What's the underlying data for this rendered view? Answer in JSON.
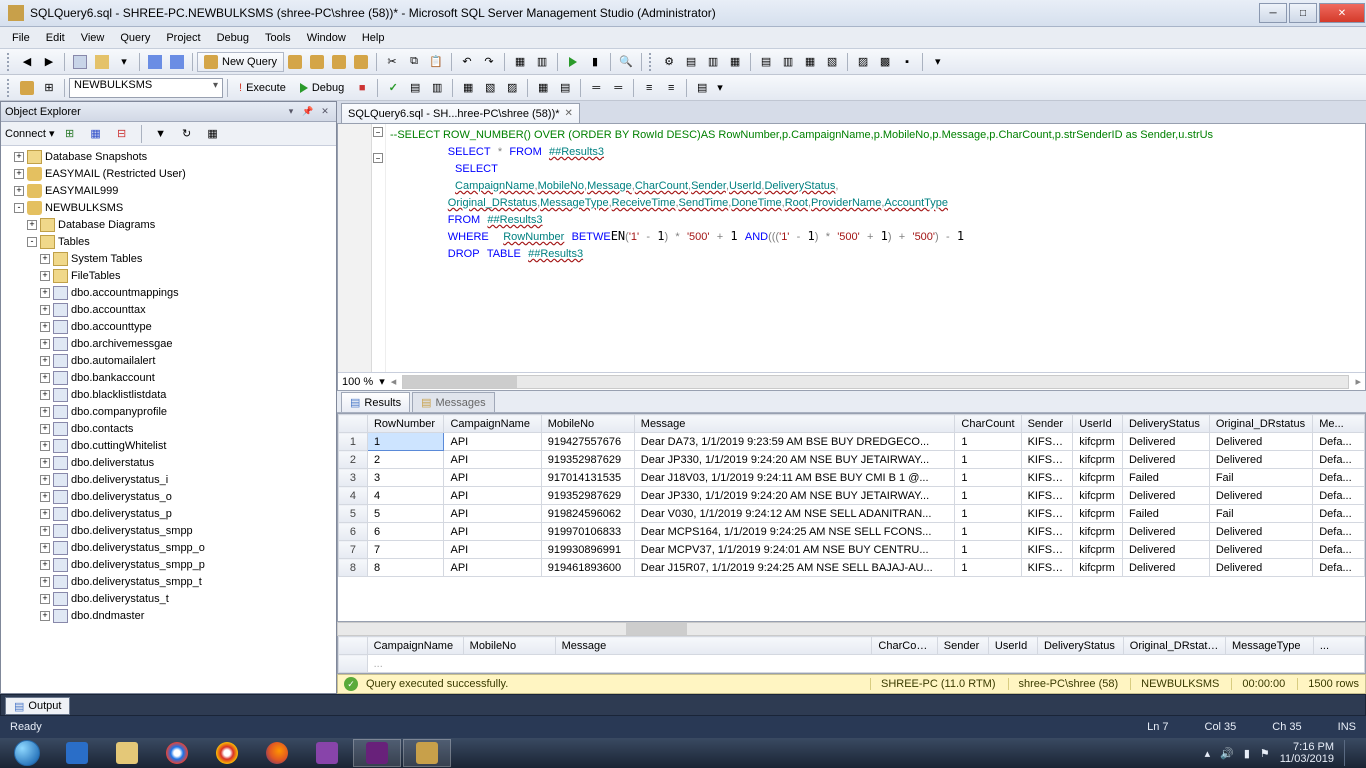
{
  "window": {
    "title": "SQLQuery6.sql - SHREE-PC.NEWBULKSMS (shree-PC\\shree (58))* - Microsoft SQL Server Management Studio (Administrator)"
  },
  "menu": [
    "File",
    "Edit",
    "View",
    "Query",
    "Project",
    "Debug",
    "Tools",
    "Window",
    "Help"
  ],
  "toolbar1": {
    "new_query": "New Query"
  },
  "toolbar2": {
    "db_select": "NEWBULKSMS",
    "execute": "Execute",
    "debug": "Debug"
  },
  "object_explorer": {
    "title": "Object Explorer",
    "connect": "Connect ▾",
    "nodes": [
      {
        "depth": 1,
        "exp": "+",
        "icon": "folder",
        "label": "Database Snapshots"
      },
      {
        "depth": 1,
        "exp": "+",
        "icon": "db",
        "label": "EASYMAIL (Restricted User)"
      },
      {
        "depth": 1,
        "exp": "+",
        "icon": "db",
        "label": "EASYMAIL999"
      },
      {
        "depth": 1,
        "exp": "-",
        "icon": "db",
        "label": "NEWBULKSMS"
      },
      {
        "depth": 2,
        "exp": "+",
        "icon": "folder",
        "label": "Database Diagrams"
      },
      {
        "depth": 2,
        "exp": "-",
        "icon": "folder",
        "label": "Tables"
      },
      {
        "depth": 3,
        "exp": "+",
        "icon": "folder",
        "label": "System Tables"
      },
      {
        "depth": 3,
        "exp": "+",
        "icon": "folder",
        "label": "FileTables"
      },
      {
        "depth": 3,
        "exp": "+",
        "icon": "table",
        "label": "dbo.accountmappings"
      },
      {
        "depth": 3,
        "exp": "+",
        "icon": "table",
        "label": "dbo.accounttax"
      },
      {
        "depth": 3,
        "exp": "+",
        "icon": "table",
        "label": "dbo.accounttype"
      },
      {
        "depth": 3,
        "exp": "+",
        "icon": "table",
        "label": "dbo.archivemessgae"
      },
      {
        "depth": 3,
        "exp": "+",
        "icon": "table",
        "label": "dbo.automailalert"
      },
      {
        "depth": 3,
        "exp": "+",
        "icon": "table",
        "label": "dbo.bankaccount"
      },
      {
        "depth": 3,
        "exp": "+",
        "icon": "table",
        "label": "dbo.blacklistlistdata"
      },
      {
        "depth": 3,
        "exp": "+",
        "icon": "table",
        "label": "dbo.companyprofile"
      },
      {
        "depth": 3,
        "exp": "+",
        "icon": "table",
        "label": "dbo.contacts"
      },
      {
        "depth": 3,
        "exp": "+",
        "icon": "table",
        "label": "dbo.cuttingWhitelist"
      },
      {
        "depth": 3,
        "exp": "+",
        "icon": "table",
        "label": "dbo.deliverstatus"
      },
      {
        "depth": 3,
        "exp": "+",
        "icon": "table",
        "label": "dbo.deliverystatus_i"
      },
      {
        "depth": 3,
        "exp": "+",
        "icon": "table",
        "label": "dbo.deliverystatus_o"
      },
      {
        "depth": 3,
        "exp": "+",
        "icon": "table",
        "label": "dbo.deliverystatus_p"
      },
      {
        "depth": 3,
        "exp": "+",
        "icon": "table",
        "label": "dbo.deliverystatus_smpp"
      },
      {
        "depth": 3,
        "exp": "+",
        "icon": "table",
        "label": "dbo.deliverystatus_smpp_o"
      },
      {
        "depth": 3,
        "exp": "+",
        "icon": "table",
        "label": "dbo.deliverystatus_smpp_p"
      },
      {
        "depth": 3,
        "exp": "+",
        "icon": "table",
        "label": "dbo.deliverystatus_smpp_t"
      },
      {
        "depth": 3,
        "exp": "+",
        "icon": "table",
        "label": "dbo.deliverystatus_t"
      },
      {
        "depth": 3,
        "exp": "+",
        "icon": "table",
        "label": "dbo.dndmaster"
      }
    ]
  },
  "editor": {
    "tab": "SQLQuery6.sql - SH...hree-PC\\shree (58))*",
    "code_html": "<span class='c-cmt'>--SELECT ROW_NUMBER() OVER (ORDER BY RowId DESC)AS RowNumber,p.CampaignName,p.MobileNo,p.Message,p.CharCount,p.strSenderID as Sender,u.strUs</span>\n        <span class='c-kw'>SELECT</span> <span class='c-gray'>*</span> <span class='c-kw'>FROM</span> <span class='c-obj'>##Results3</span>\n         <span class='c-kw'>SELECT</span>\n         <span class='c-obj'>CampaignName</span><span class='c-gray'>,</span><span class='c-obj'>MobileNo</span><span class='c-gray'>,</span><span class='c-obj'>Message</span><span class='c-gray'>,</span><span class='c-obj'>CharCount</span><span class='c-gray'>,</span><span class='c-obj'>Sender</span><span class='c-gray'>,</span><span class='c-obj'>UserId</span><span class='c-gray'>,</span><span class='c-obj'>DeliveryStatus</span><span class='c-gray'>,</span>\n        <span class='c-obj'>Original_DRstatus</span><span class='c-gray'>,</span><span class='c-obj'>MessageType</span><span class='c-gray'>,</span><span class='c-obj'>ReceiveTime</span><span class='c-gray'>,</span><span class='c-obj'>SendTime</span><span class='c-gray'>,</span><span class='c-obj'>DoneTime</span><span class='c-gray'>,</span><span class='c-obj'>Root</span><span class='c-gray'>,</span><span class='c-obj'>ProviderName</span><span class='c-gray'>,</span><span class='c-obj'>AccountType</span>\n        <span class='c-kw'>FROM</span> <span class='c-obj'>##Results3</span>\n        <span class='c-kw'>WHERE</span>  <span class='c-obj'>RowNumber</span> <span class='c-kw'>BETWE</span>EN<span class='c-gray'>(</span><span class='c-str'>'1'</span> <span class='c-gray'>-</span> 1<span class='c-gray'>)</span> <span class='c-gray'>*</span> <span class='c-str'>'500'</span> <span class='c-gray'>+</span> 1 <span class='c-kw'>AND</span><span class='c-gray'>(((</span><span class='c-str'>'1'</span> <span class='c-gray'>-</span> 1<span class='c-gray'>)</span> <span class='c-gray'>*</span> <span class='c-str'>'500'</span> <span class='c-gray'>+</span> 1<span class='c-gray'>)</span> <span class='c-gray'>+</span> <span class='c-str'>'500'</span><span class='c-gray'>)</span> <span class='c-gray'>-</span> 1\n        <span class='c-kw'>DROP</span> <span class='c-kw'>TABLE</span> <span class='c-obj'>##Results3</span>",
    "zoom": "100 %"
  },
  "results": {
    "tab_results": "Results",
    "tab_messages": "Messages",
    "columns": [
      "",
      "RowNumber",
      "CampaignName",
      "MobileNo",
      "Message",
      "CharCount",
      "Sender",
      "UserId",
      "DeliveryStatus",
      "Original_DRstatus",
      "Me..."
    ],
    "rows": [
      [
        "1",
        "1",
        "API",
        "919427557676",
        "Dear DA73, 1/1/2019 9:23:59 AM   BSE BUY DREDGECO...",
        "1",
        "KIFSTR",
        "kifcprm",
        "Delivered",
        "Delivered",
        "Defa..."
      ],
      [
        "2",
        "2",
        "API",
        "919352987629",
        "Dear JP330, 1/1/2019 9:24:20 AM   NSE BUY JETAIRWAY...",
        "1",
        "KIFSTR",
        "kifcprm",
        "Delivered",
        "Delivered",
        "Defa..."
      ],
      [
        "3",
        "3",
        "API",
        "917014131535",
        "Dear J18V03, 1/1/2019 9:24:11 AM   BSE BUY CMI B   1 @...",
        "1",
        "KIFSTR",
        "kifcprm",
        "Failed",
        "Fail",
        "Defa..."
      ],
      [
        "4",
        "4",
        "API",
        "919352987629",
        "Dear JP330, 1/1/2019 9:24:20 AM   NSE BUY JETAIRWAY...",
        "1",
        "KIFSTR",
        "kifcprm",
        "Delivered",
        "Delivered",
        "Defa..."
      ],
      [
        "5",
        "5",
        "API",
        "919824596062",
        "Dear V030, 1/1/2019 9:24:12 AM   NSE SELL ADANITRAN...",
        "1",
        "KIFSTR",
        "kifcprm",
        "Failed",
        "Fail",
        "Defa..."
      ],
      [
        "6",
        "6",
        "API",
        "919970106833",
        "Dear MCPS164, 1/1/2019 9:24:25 AM   NSE SELL FCONS...",
        "1",
        "KIFSTR",
        "kifcprm",
        "Delivered",
        "Delivered",
        "Defa..."
      ],
      [
        "7",
        "7",
        "API",
        "919930896991",
        "Dear MCPV37, 1/1/2019 9:24:01 AM   NSE BUY CENTRU...",
        "1",
        "KIFSTR",
        "kifcprm",
        "Delivered",
        "Delivered",
        "Defa..."
      ],
      [
        "8",
        "8",
        "API",
        "919461893600",
        "Dear J15R07, 1/1/2019 9:24:25 AM   NSE SELL BAJAJ-AU...",
        "1",
        "KIFSTR",
        "kifcprm",
        "Delivered",
        "Delivered",
        "Defa..."
      ]
    ],
    "second_columns": [
      "",
      "CampaignName",
      "MobileNo",
      "Message",
      "CharCount",
      "Sender",
      "UserId",
      "DeliveryStatus",
      "Original_DRstatus",
      "MessageType",
      "..."
    ]
  },
  "status_yellow": {
    "msg": "Query executed successfully.",
    "server": "SHREE-PC (11.0 RTM)",
    "login": "shree-PC\\shree (58)",
    "db": "NEWBULKSMS",
    "elapsed": "00:00:00",
    "rows": "1500 rows"
  },
  "output_tab": "Output",
  "statusbar": {
    "ready": "Ready",
    "ln": "Ln 7",
    "col": "Col 35",
    "ch": "Ch 35",
    "ins": "INS"
  },
  "taskbar": {
    "time": "7:16 PM",
    "date": "11/03/2019"
  }
}
